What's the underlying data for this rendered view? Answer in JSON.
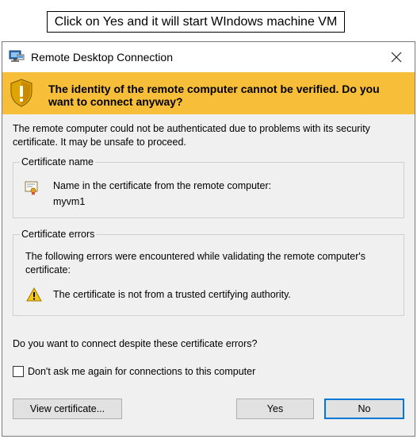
{
  "callout": {
    "text": "Click on Yes and it will start WIndows machine VM"
  },
  "window": {
    "title": "Remote Desktop Connection",
    "close_label": "Close",
    "warning": {
      "text": "The identity of the remote computer cannot be verified. Do you want to connect anyway?",
      "icon": "shield-warning-icon",
      "color": "#f7be3a"
    },
    "description": "The remote computer could not be authenticated due to problems with its security certificate. It may be unsafe to proceed.",
    "certificate_name": {
      "legend": "Certificate name",
      "label": "Name in the certificate from the remote computer:",
      "value": "myvm1",
      "icon": "certificate-icon"
    },
    "certificate_errors": {
      "legend": "Certificate errors",
      "intro": "The following errors were encountered while validating the remote computer's certificate:",
      "errors": [
        "The certificate is not from a trusted certifying authority."
      ],
      "icon": "warning-triangle-icon"
    },
    "question": "Do you want to connect despite these certificate errors?",
    "checkbox": {
      "label": "Don't ask me again for connections to this computer",
      "checked": false
    },
    "buttons": {
      "view_certificate": "View certificate...",
      "yes": "Yes",
      "no": "No"
    },
    "focus_color": "#0078d7"
  }
}
